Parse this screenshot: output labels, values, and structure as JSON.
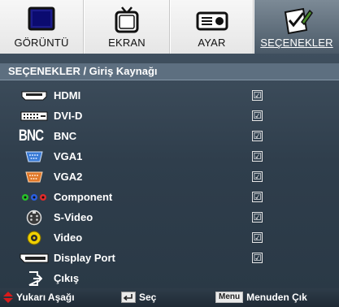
{
  "tabs": [
    {
      "label": "GÖRÜNTÜ",
      "icon": "display-icon",
      "active": false
    },
    {
      "label": "EKRAN",
      "icon": "tv-icon",
      "active": false
    },
    {
      "label": "AYAR",
      "icon": "projector-icon",
      "active": false
    },
    {
      "label": "SEÇENEKLER",
      "icon": "options-icon",
      "active": true
    }
  ],
  "breadcrumb": "SEÇENEKLER / Giriş Kaynağı",
  "sources": [
    {
      "label": "HDMI",
      "icon": "hdmi-icon",
      "checked": true,
      "check": "☑"
    },
    {
      "label": "DVI-D",
      "icon": "dvi-icon",
      "checked": true,
      "check": "☑"
    },
    {
      "label": "BNC",
      "icon": "bnc-icon",
      "icon_text": "BNC",
      "checked": true,
      "check": "☑"
    },
    {
      "label": "VGA1",
      "icon": "vga1-icon",
      "checked": true,
      "check": "☑"
    },
    {
      "label": "VGA2",
      "icon": "vga2-icon",
      "checked": true,
      "check": "☑"
    },
    {
      "label": "Component",
      "icon": "component-icon",
      "checked": true,
      "check": "☑"
    },
    {
      "label": "S-Video",
      "icon": "svideo-icon",
      "checked": true,
      "check": "☑"
    },
    {
      "label": "Video",
      "icon": "video-icon",
      "checked": true,
      "check": "☑"
    },
    {
      "label": "Display Port",
      "icon": "displayport-icon",
      "checked": true,
      "check": "☑"
    }
  ],
  "exit": {
    "label": "Çıkış",
    "icon": "exit-icon"
  },
  "footer": {
    "nav_label": "Yukarı Aşağı",
    "select_label": "Seç",
    "menu_key": "Menu",
    "menu_label": "Menuden Çık"
  },
  "colors": {
    "active_tab": "#5a6876",
    "panel": "#2f3e4c",
    "accent_red": "#d81b1b",
    "vga1_blue": "#3a7bd5",
    "vga2_orange": "#e0782a",
    "video_yellow": "#f0d000"
  }
}
